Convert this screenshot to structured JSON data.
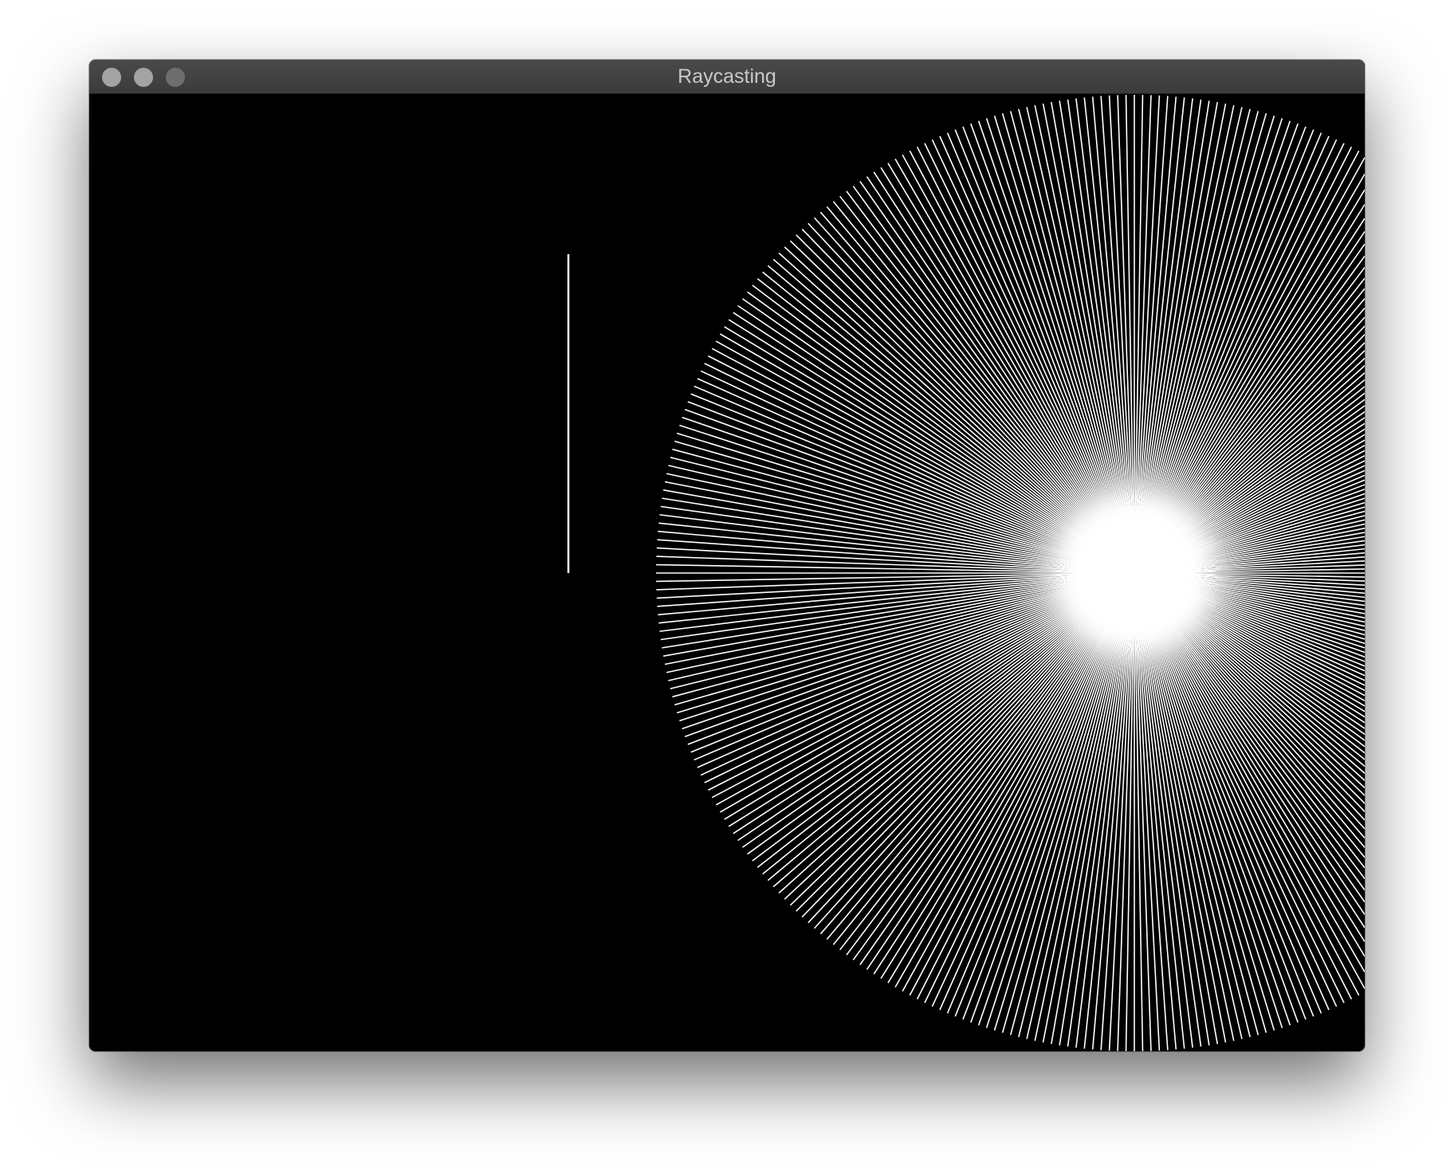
{
  "window": {
    "title": "Raycasting",
    "controls": [
      "close-button",
      "minimize-button",
      "zoom-button"
    ]
  },
  "scene": {
    "background_color": "#000000",
    "ray_color": "#ffffff",
    "wall_color": "#ffffff",
    "ray_count": 360,
    "wall_count": 1
  }
}
